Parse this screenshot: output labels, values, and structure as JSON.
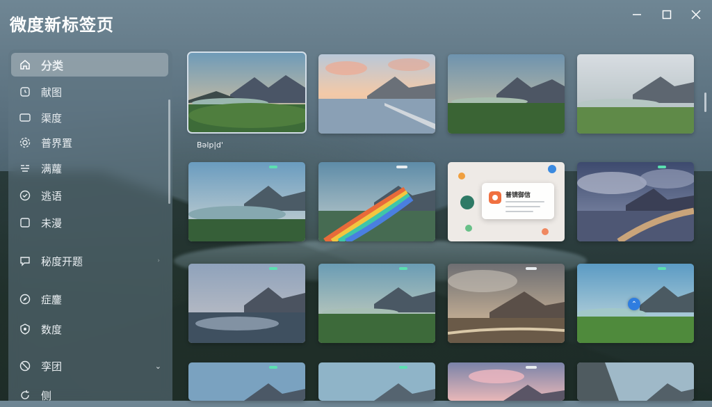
{
  "app": {
    "title": "微度新标签页"
  },
  "window_controls": [
    "minimize-icon",
    "maximize-icon",
    "close-icon"
  ],
  "sidebar": {
    "items": [
      {
        "label": "分类",
        "icon": "home-icon",
        "active": true
      },
      {
        "label": "献图",
        "icon": "clock-icon"
      },
      {
        "label": "渠度",
        "icon": "rectangle-icon"
      },
      {
        "label": "普界置",
        "icon": "gear-icon"
      },
      {
        "label": "满蘿",
        "icon": "grid-icon"
      },
      {
        "label": "逃语",
        "icon": "badge-icon"
      },
      {
        "label": "未漫",
        "icon": "square-icon"
      },
      {
        "label": "秘度开题",
        "icon": "chat-icon"
      },
      {
        "label": "症鏖",
        "icon": "compass-icon"
      },
      {
        "label": "数度",
        "icon": "shield-icon"
      },
      {
        "label": "孪团",
        "icon": "block-icon",
        "expandable": true
      },
      {
        "label": "侧",
        "icon": "refresh-icon"
      }
    ]
  },
  "wallpapers": {
    "selected_caption": "Bəlp|d'",
    "tiles": [
      {
        "name": "mountain-lake-dawn",
        "selected": true
      },
      {
        "name": "mountain-lake-sunrise-clouds"
      },
      {
        "name": "mountain-valley-green"
      },
      {
        "name": "mountain-lake-misty"
      },
      {
        "name": "mountain-lake-blue"
      },
      {
        "name": "mountain-lake-rainbow"
      },
      {
        "name": "app-dialog-preview",
        "dialog_title": "普镜御信"
      },
      {
        "name": "storm-clouds-road"
      },
      {
        "name": "mountain-lake-dusk"
      },
      {
        "name": "mountain-valley-morning"
      },
      {
        "name": "rainbow-canyon-road"
      },
      {
        "name": "mountain-meadow-blue"
      },
      {
        "name": "mountain-lake-evening"
      },
      {
        "name": "mountain-lake-pale"
      },
      {
        "name": "mountain-pink-sky"
      },
      {
        "name": "cliff-valley"
      }
    ]
  }
}
